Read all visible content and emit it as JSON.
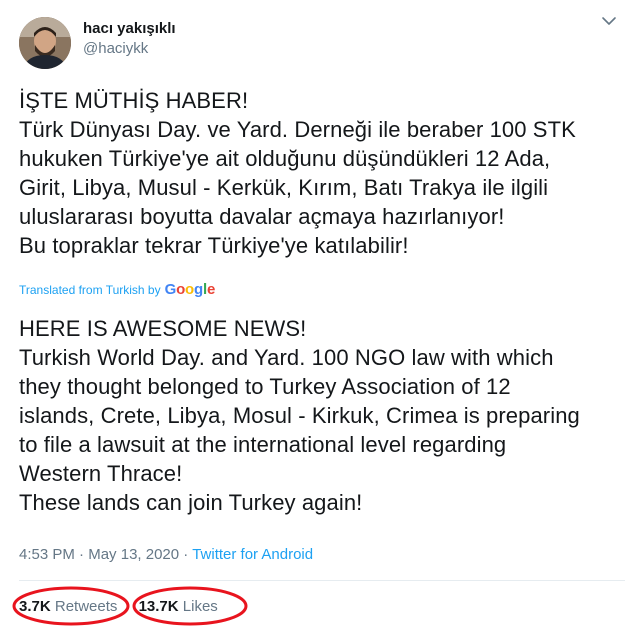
{
  "author": {
    "display_name": "hacı yakışıklı",
    "handle": "@haciykk"
  },
  "icons": {
    "menu": "chevron-down-icon"
  },
  "original_text": "İŞTE MÜTHİŞ HABER!\nTürk Dünyası Day. ve Yard. Derneği ile beraber 100 STK\nhukuken Türkiye'ye ait olduğunu düşündükleri 12 Ada,\nGirit, Libya, Musul - Kerkük, Kırım, Batı Trakya ile ilgili\nuluslararası boyutta davalar açmaya hazırlanıyor!\nBu topraklar tekrar Türkiye'ye katılabilir!",
  "translation": {
    "label": "Translated from Turkish by",
    "provider": "Google",
    "text": "HERE IS AWESOME NEWS!\n Turkish World Day. and Yard. 100 NGO law with which\nthey thought belonged to Turkey Association of 12\nislands, Crete, Libya, Mosul - Kirkuk, Crimea is preparing\nto file a lawsuit at the international level regarding\nWestern Thrace!\n These lands can join Turkey again!"
  },
  "meta": {
    "time": "4:53 PM",
    "separator": "·",
    "date": "May 13, 2020",
    "source": "Twitter for Android"
  },
  "stats": {
    "retweets_count": "3.7K",
    "retweets_label": "Retweets",
    "likes_count": "13.7K",
    "likes_label": "Likes"
  },
  "colors": {
    "link": "#1da1f2",
    "secondary_text": "#657786",
    "annotation_circle": "#e8141e"
  }
}
